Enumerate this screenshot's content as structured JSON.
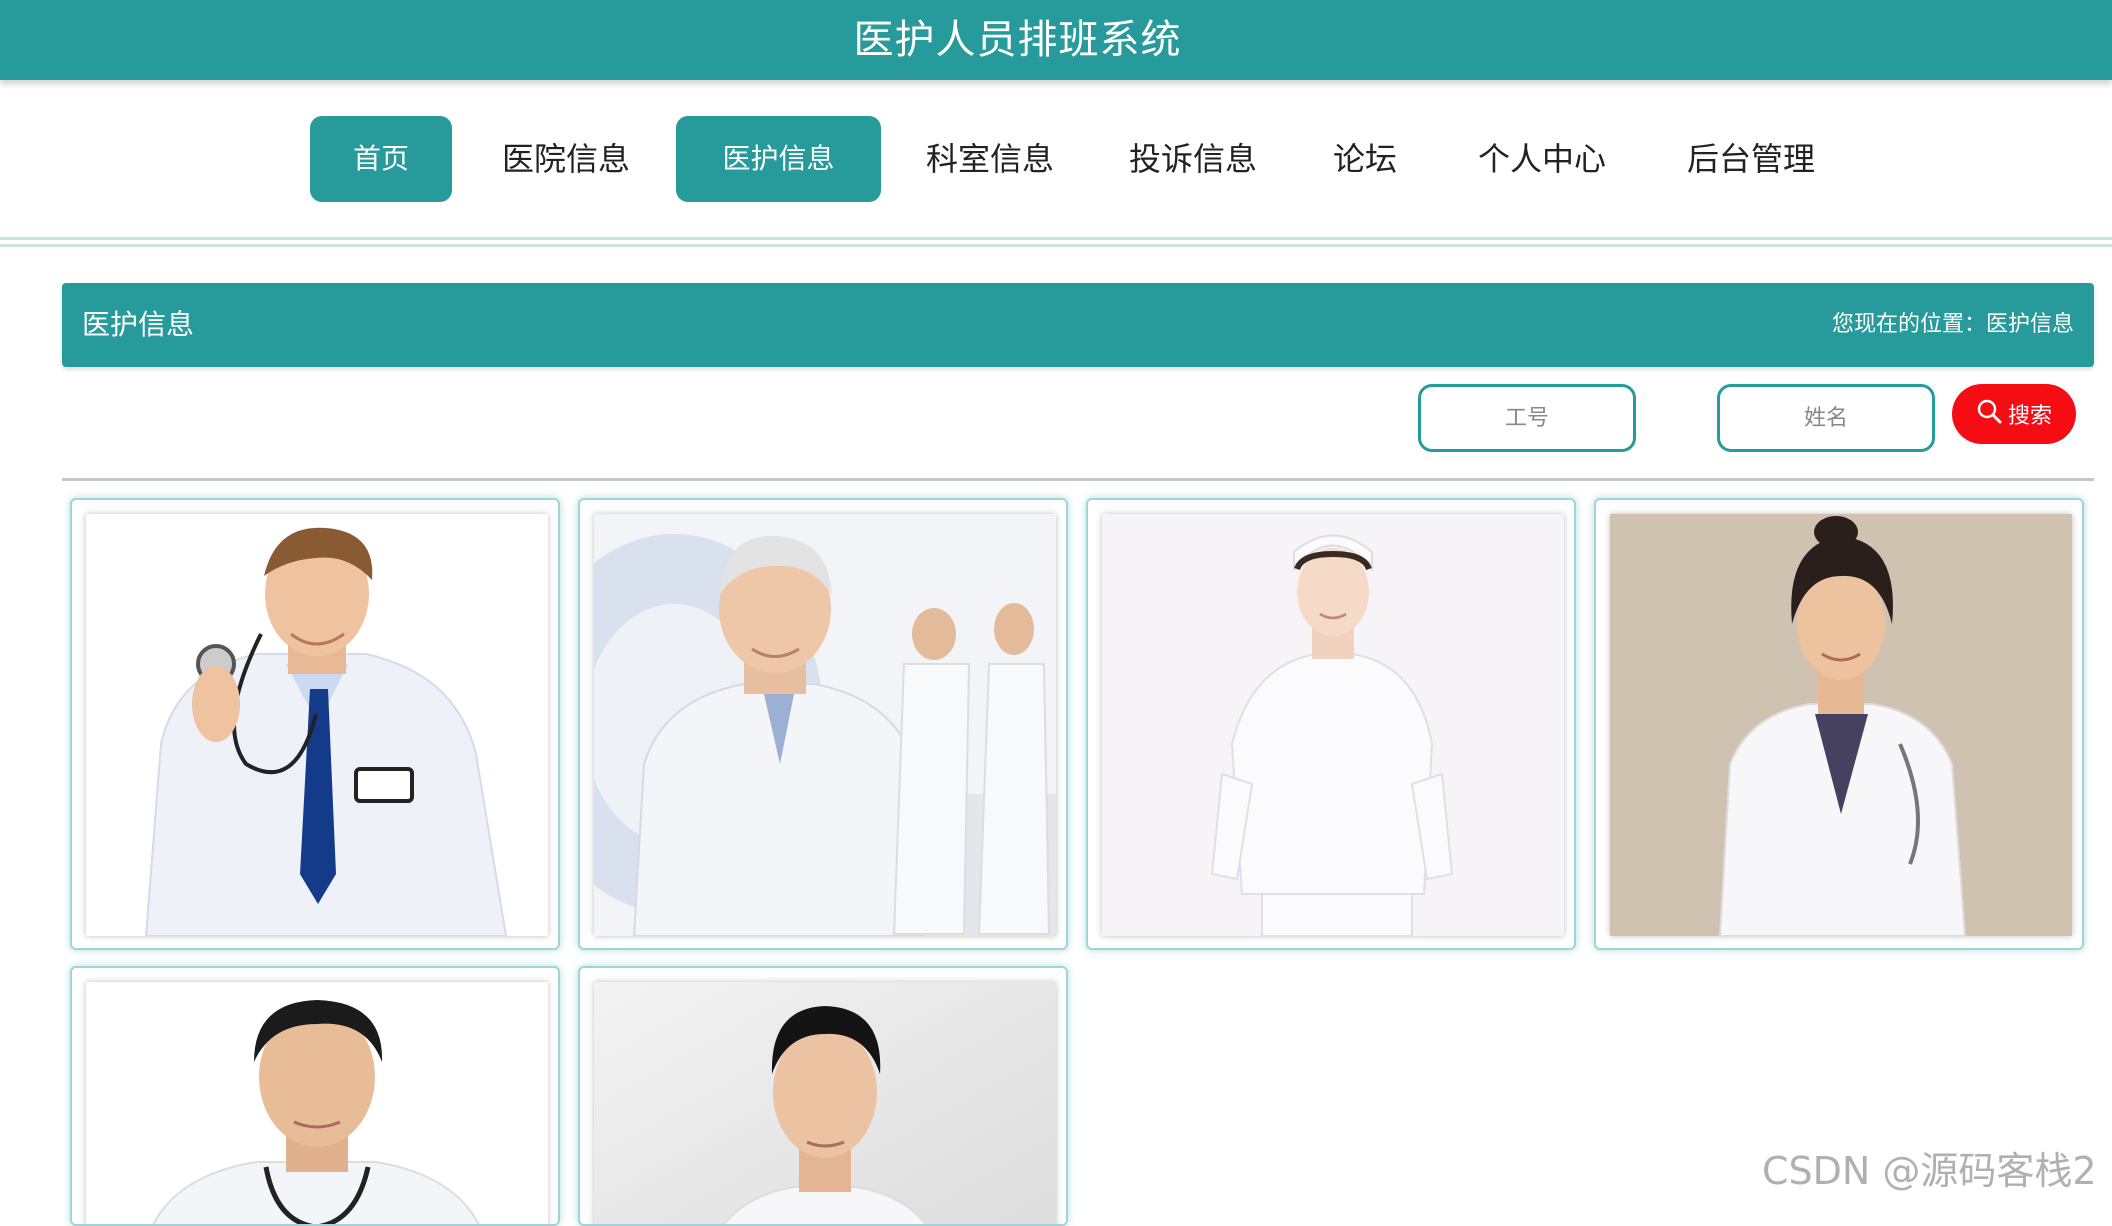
{
  "app": {
    "title": "医护人员排班系统"
  },
  "nav": {
    "items": [
      {
        "label": "首页",
        "active": true
      },
      {
        "label": "医院信息",
        "active": false
      },
      {
        "label": "医护信息",
        "active": true
      },
      {
        "label": "科室信息",
        "active": false
      },
      {
        "label": "投诉信息",
        "active": false
      },
      {
        "label": "论坛",
        "active": false
      },
      {
        "label": "个人中心",
        "active": false
      },
      {
        "label": "后台管理",
        "active": false
      }
    ]
  },
  "section": {
    "title": "医护信息",
    "breadcrumb": "您现在的位置：医护信息"
  },
  "search": {
    "id_placeholder": "工号",
    "name_placeholder": "姓名",
    "button_label": "搜索",
    "button_icon": "search-icon"
  },
  "cards": [
    {
      "photo": "male-doctor-with-stethoscope-photo"
    },
    {
      "photo": "senior-doctor-hospital-photo"
    },
    {
      "photo": "nurse-in-white-uniform-photo"
    },
    {
      "photo": "female-doctor-photo"
    },
    {
      "photo": "young-male-doctor-photo"
    },
    {
      "photo": "male-doctor-portrait-photo"
    }
  ],
  "watermark": "CSDN @源码客栈2",
  "colors": {
    "primary": "#279a9b",
    "search_button": "#f60d13",
    "background": "#ffffff"
  }
}
